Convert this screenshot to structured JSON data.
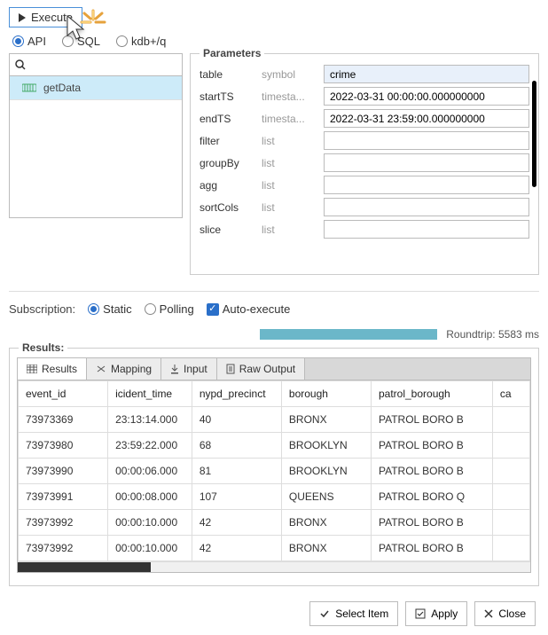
{
  "execute_label": "Execute",
  "tabs": {
    "api": "API",
    "sql": "SQL",
    "kdb": "kdb+/q",
    "selected": "api"
  },
  "sidebar": {
    "items": [
      {
        "label": "getData"
      }
    ]
  },
  "parameters": {
    "legend": "Parameters",
    "rows": [
      {
        "name": "table",
        "type": "symbol",
        "value": "crime",
        "hl": true
      },
      {
        "name": "startTS",
        "type": "timesta...",
        "value": "2022-03-31 00:00:00.000000000"
      },
      {
        "name": "endTS",
        "type": "timesta...",
        "value": "2022-03-31 23:59:00.000000000"
      },
      {
        "name": "filter",
        "type": "list",
        "value": ""
      },
      {
        "name": "groupBy",
        "type": "list",
        "value": ""
      },
      {
        "name": "agg",
        "type": "list",
        "value": ""
      },
      {
        "name": "sortCols",
        "type": "list",
        "value": ""
      },
      {
        "name": "slice",
        "type": "list",
        "value": ""
      }
    ]
  },
  "subscription": {
    "label": "Subscription:",
    "static": "Static",
    "polling": "Polling",
    "auto_exec": "Auto-execute",
    "selected": "static",
    "auto_checked": true
  },
  "roundtrip": {
    "text": "Roundtrip: 5583 ms"
  },
  "results": {
    "legend": "Results:",
    "tabs": {
      "results": "Results",
      "mapping": "Mapping",
      "input": "Input",
      "raw": "Raw Output"
    },
    "columns": [
      "event_id",
      "icident_time",
      "nypd_precinct",
      "borough",
      "patrol_borough",
      "ca"
    ],
    "rows": [
      [
        "73973369",
        "23:13:14.000",
        "40",
        "BRONX",
        "PATROL BORO B",
        ""
      ],
      [
        "73973980",
        "23:59:22.000",
        "68",
        "BROOKLYN",
        "PATROL BORO B",
        ""
      ],
      [
        "73973990",
        "00:00:06.000",
        "81",
        "BROOKLYN",
        "PATROL BORO B",
        ""
      ],
      [
        "73973991",
        "00:00:08.000",
        "107",
        "QUEENS",
        "PATROL BORO Q",
        ""
      ],
      [
        "73973992",
        "00:00:10.000",
        "42",
        "BRONX",
        "PATROL BORO B",
        ""
      ],
      [
        "73973992",
        "00:00:10.000",
        "42",
        "BRONX",
        "PATROL BORO B",
        ""
      ]
    ]
  },
  "buttons": {
    "select_item": "Select Item",
    "apply": "Apply",
    "close": "Close"
  }
}
